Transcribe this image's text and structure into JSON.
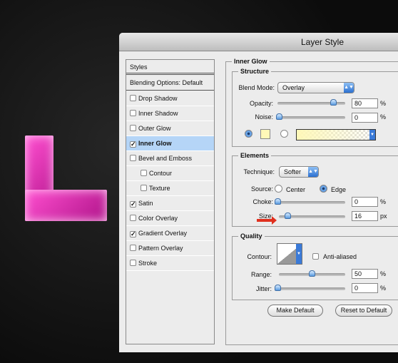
{
  "window": {
    "title": "Layer Style"
  },
  "canvas": {
    "letter": "L",
    "letter_color": "#e83cbf"
  },
  "styles_panel": {
    "header": "Styles",
    "blending_options": "Blending Options: Default",
    "items": [
      {
        "label": "Drop Shadow",
        "checked": false,
        "selected": false,
        "indent": false
      },
      {
        "label": "Inner Shadow",
        "checked": false,
        "selected": false,
        "indent": false
      },
      {
        "label": "Outer Glow",
        "checked": false,
        "selected": false,
        "indent": false
      },
      {
        "label": "Inner Glow",
        "checked": true,
        "selected": true,
        "indent": false
      },
      {
        "label": "Bevel and Emboss",
        "checked": false,
        "selected": false,
        "indent": false
      },
      {
        "label": "Contour",
        "checked": false,
        "selected": false,
        "indent": true
      },
      {
        "label": "Texture",
        "checked": false,
        "selected": false,
        "indent": true
      },
      {
        "label": "Satin",
        "checked": true,
        "selected": false,
        "indent": false
      },
      {
        "label": "Color Overlay",
        "checked": false,
        "selected": false,
        "indent": false
      },
      {
        "label": "Gradient Overlay",
        "checked": true,
        "selected": false,
        "indent": false
      },
      {
        "label": "Pattern Overlay",
        "checked": false,
        "selected": false,
        "indent": false
      },
      {
        "label": "Stroke",
        "checked": false,
        "selected": false,
        "indent": false
      }
    ]
  },
  "inner_glow": {
    "title": "Inner Glow",
    "structure": {
      "title": "Structure",
      "blend_mode_label": "Blend Mode:",
      "blend_mode": "Overlay",
      "opacity_label": "Opacity:",
      "opacity": "80",
      "opacity_unit": "%",
      "noise_label": "Noise:",
      "noise": "0",
      "noise_unit": "%",
      "color": "#fff8b8",
      "color_selected": true
    },
    "elements": {
      "title": "Elements",
      "technique_label": "Technique:",
      "technique": "Softer",
      "source_label": "Source:",
      "source_center": "Center",
      "source_edge": "Edge",
      "source": "Edge",
      "choke_label": "Choke:",
      "choke": "0",
      "choke_unit": "%",
      "size_label": "Size:",
      "size": "16",
      "size_unit": "px"
    },
    "quality": {
      "title": "Quality",
      "contour_label": "Contour:",
      "anti_aliased_label": "Anti-aliased",
      "anti_aliased": false,
      "range_label": "Range:",
      "range": "50",
      "range_unit": "%",
      "jitter_label": "Jitter:",
      "jitter": "0",
      "jitter_unit": "%"
    },
    "make_default": "Make Default",
    "reset_default": "Reset to Default"
  }
}
